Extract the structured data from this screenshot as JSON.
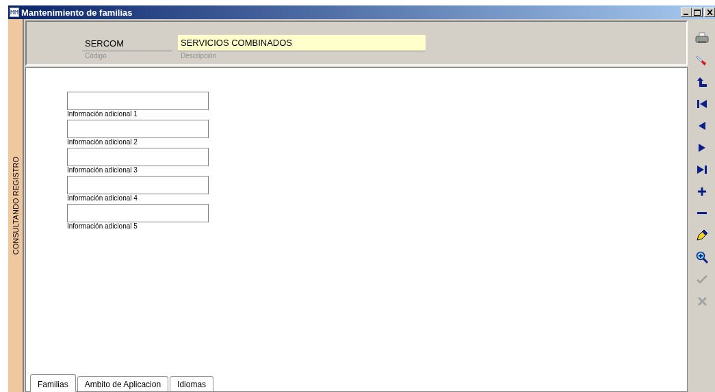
{
  "window": {
    "title": "Mantenimiento de familias"
  },
  "mode_label": "CONSULTANDO REGISTRO",
  "header": {
    "code": {
      "value": "SERCOM",
      "label": "Código"
    },
    "description": {
      "value": "SERVICIOS COMBINADOS",
      "label": "Descripción",
      "focused": true
    }
  },
  "fields": [
    {
      "label": "Información adicional 1"
    },
    {
      "label": "Información adicional 2"
    },
    {
      "label": "Información adicional 3"
    },
    {
      "label": "Información adicional 4"
    },
    {
      "label": "Información adicional 5"
    }
  ],
  "tabs": [
    {
      "label": "Familias",
      "selected": true
    },
    {
      "label": "Ambito de Aplicacion",
      "selected": false
    },
    {
      "label": "Idiomas",
      "selected": false
    }
  ],
  "toolbar": [
    {
      "kind": "print",
      "disabled": false
    },
    {
      "kind": "brush",
      "disabled": false
    },
    {
      "kind": "return",
      "disabled": false
    },
    {
      "kind": "first",
      "disabled": false
    },
    {
      "kind": "prev",
      "disabled": false
    },
    {
      "kind": "next",
      "disabled": false
    },
    {
      "kind": "last",
      "disabled": false
    },
    {
      "kind": "add",
      "disabled": false
    },
    {
      "kind": "remove",
      "disabled": false
    },
    {
      "kind": "edit",
      "disabled": false
    },
    {
      "kind": "search",
      "disabled": false
    },
    {
      "kind": "accept",
      "disabled": true
    },
    {
      "kind": "cancel",
      "disabled": true
    }
  ]
}
